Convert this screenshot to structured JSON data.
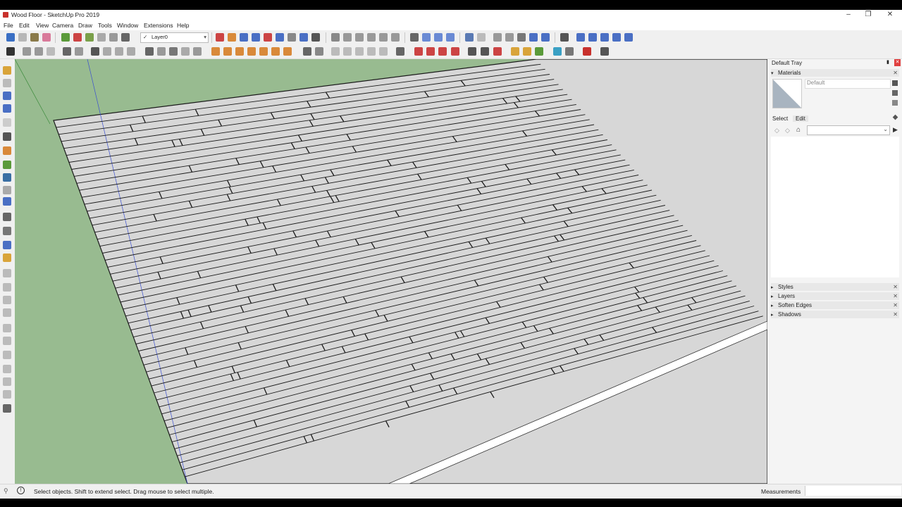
{
  "window": {
    "title": "Wood Floor - SketchUp Pro 2019",
    "minimize": "‒",
    "restore": "❐",
    "close": "✕"
  },
  "menu": [
    "File",
    "Edit",
    "View",
    "Camera",
    "Draw",
    "Tools",
    "Window",
    "Extensions",
    "Help"
  ],
  "toolbar": {
    "layer_check": "✓",
    "layer_value": "Layer0",
    "layer_arrow": "▾"
  },
  "tray": {
    "title": "Default Tray",
    "pin": "📌",
    "close": "✕",
    "materials": {
      "header": "Materials",
      "current_name": "Default",
      "tab_select": "Select",
      "tab_edit": "Edit",
      "search_placeholder": ""
    },
    "sections": [
      "Styles",
      "Layers",
      "Soften Edges",
      "Shadows"
    ]
  },
  "status": {
    "message": "Select objects. Shift to extend select. Drag mouse to select multiple.",
    "measurements_label": "Measurements",
    "measurements_value": ""
  },
  "colors": {
    "sky_ground": "#98bb90",
    "floor": "#d7d7d7",
    "plank_line": "#1a1a1a",
    "accent_red": "#c8312c"
  }
}
